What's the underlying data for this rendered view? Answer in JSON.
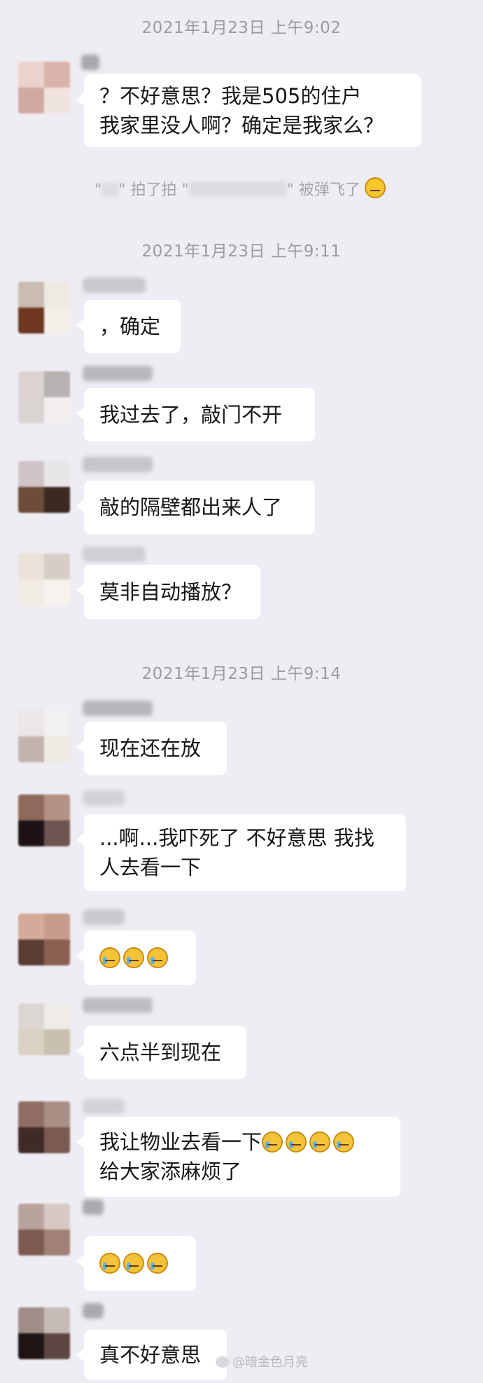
{
  "timestamps": [
    "2021年1月23日 上午9:02",
    "2021年1月23日 上午9:11",
    "2021年1月23日 上午9:14"
  ],
  "system": {
    "before": "\"",
    "mid1": "\" 拍了拍 \"",
    "mid2": "\" 被弹飞了"
  },
  "messages": [
    {
      "lines": [
        "？不好意思？我是505的住户",
        "我家里没人啊？确定是我家么？"
      ]
    },
    {
      "lines": [
        "，确定"
      ]
    },
    {
      "lines": [
        "我过去了，敲门不开"
      ]
    },
    {
      "lines": [
        "敲的隔壁都出来人了"
      ]
    },
    {
      "lines": [
        "莫非自动播放？"
      ]
    },
    {
      "lines": [
        "现在还在放"
      ]
    },
    {
      "lines": [
        "...啊...我吓死了 不好意思 我找",
        "人去看一下"
      ]
    },
    {
      "lines": [
        ""
      ]
    },
    {
      "lines": [
        "六点半到现在"
      ]
    },
    {
      "lines": [
        "我让物业去看一下",
        "给大家添麻烦了"
      ]
    },
    {
      "lines": [
        ""
      ]
    },
    {
      "lines": [
        "真不好意思"
      ]
    }
  ],
  "emoji": {
    "tear_smile": "tear-smile-icon",
    "loudly_crying": "loudly-crying-icon",
    "laughing": "laughing-icon"
  },
  "watermark": "@暗金色月亮",
  "colors": {
    "background": "#eeedf3",
    "bubble": "#ffffff",
    "timestamp": "#9a9aa2"
  }
}
